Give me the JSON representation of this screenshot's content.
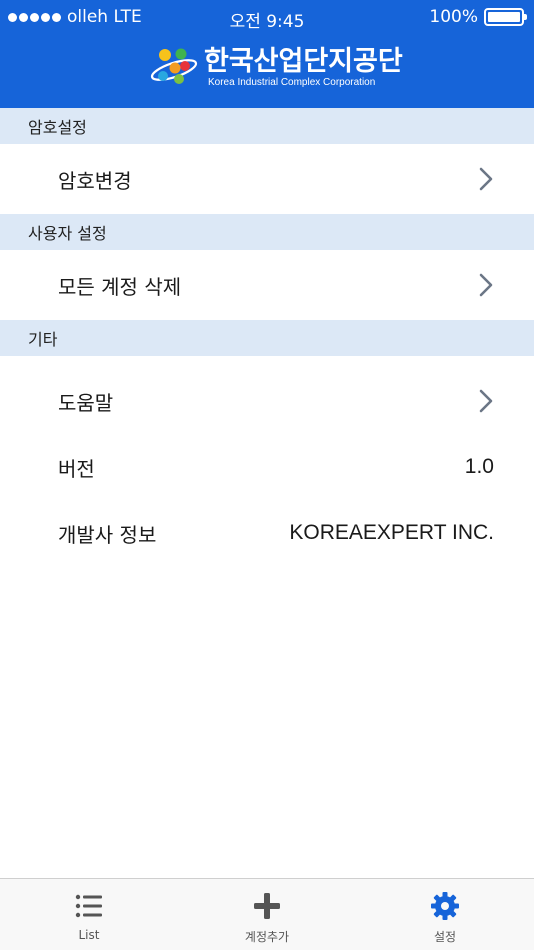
{
  "status_bar": {
    "carrier": "olleh",
    "network": "LTE",
    "time": "오전 9:45",
    "battery_percent": "100%",
    "battery_level": 1.0
  },
  "header": {
    "logo_korean": "한국산업단지공단",
    "logo_english": "Korea Industrial Complex Corporation"
  },
  "sections": [
    {
      "title": "암호설정",
      "items": [
        {
          "label": "암호변경",
          "icon": "chevron-right-icon"
        }
      ]
    },
    {
      "title": "사용자 설정",
      "items": [
        {
          "label": "모든 계정 삭제",
          "icon": "chevron-right-icon"
        }
      ]
    },
    {
      "title": "기타",
      "items": [
        {
          "label": "도움말",
          "icon": "chevron-right-icon"
        },
        {
          "label": "버전",
          "value": "1.0"
        },
        {
          "label": "개발사 정보",
          "value": "KOREAEXPERT INC."
        }
      ]
    }
  ],
  "tabbar": {
    "tabs": [
      {
        "label": "List",
        "icon": "list-icon",
        "active": false
      },
      {
        "label": "계정추가",
        "icon": "plus-icon",
        "active": false
      },
      {
        "label": "설정",
        "icon": "gear-icon",
        "active": true
      }
    ]
  },
  "colors": {
    "header_bg": "#1664d9",
    "section_bg": "#dce8f6",
    "chevron": "#6b7686",
    "tab_inactive": "#555555",
    "tab_active": "#1664d9"
  }
}
